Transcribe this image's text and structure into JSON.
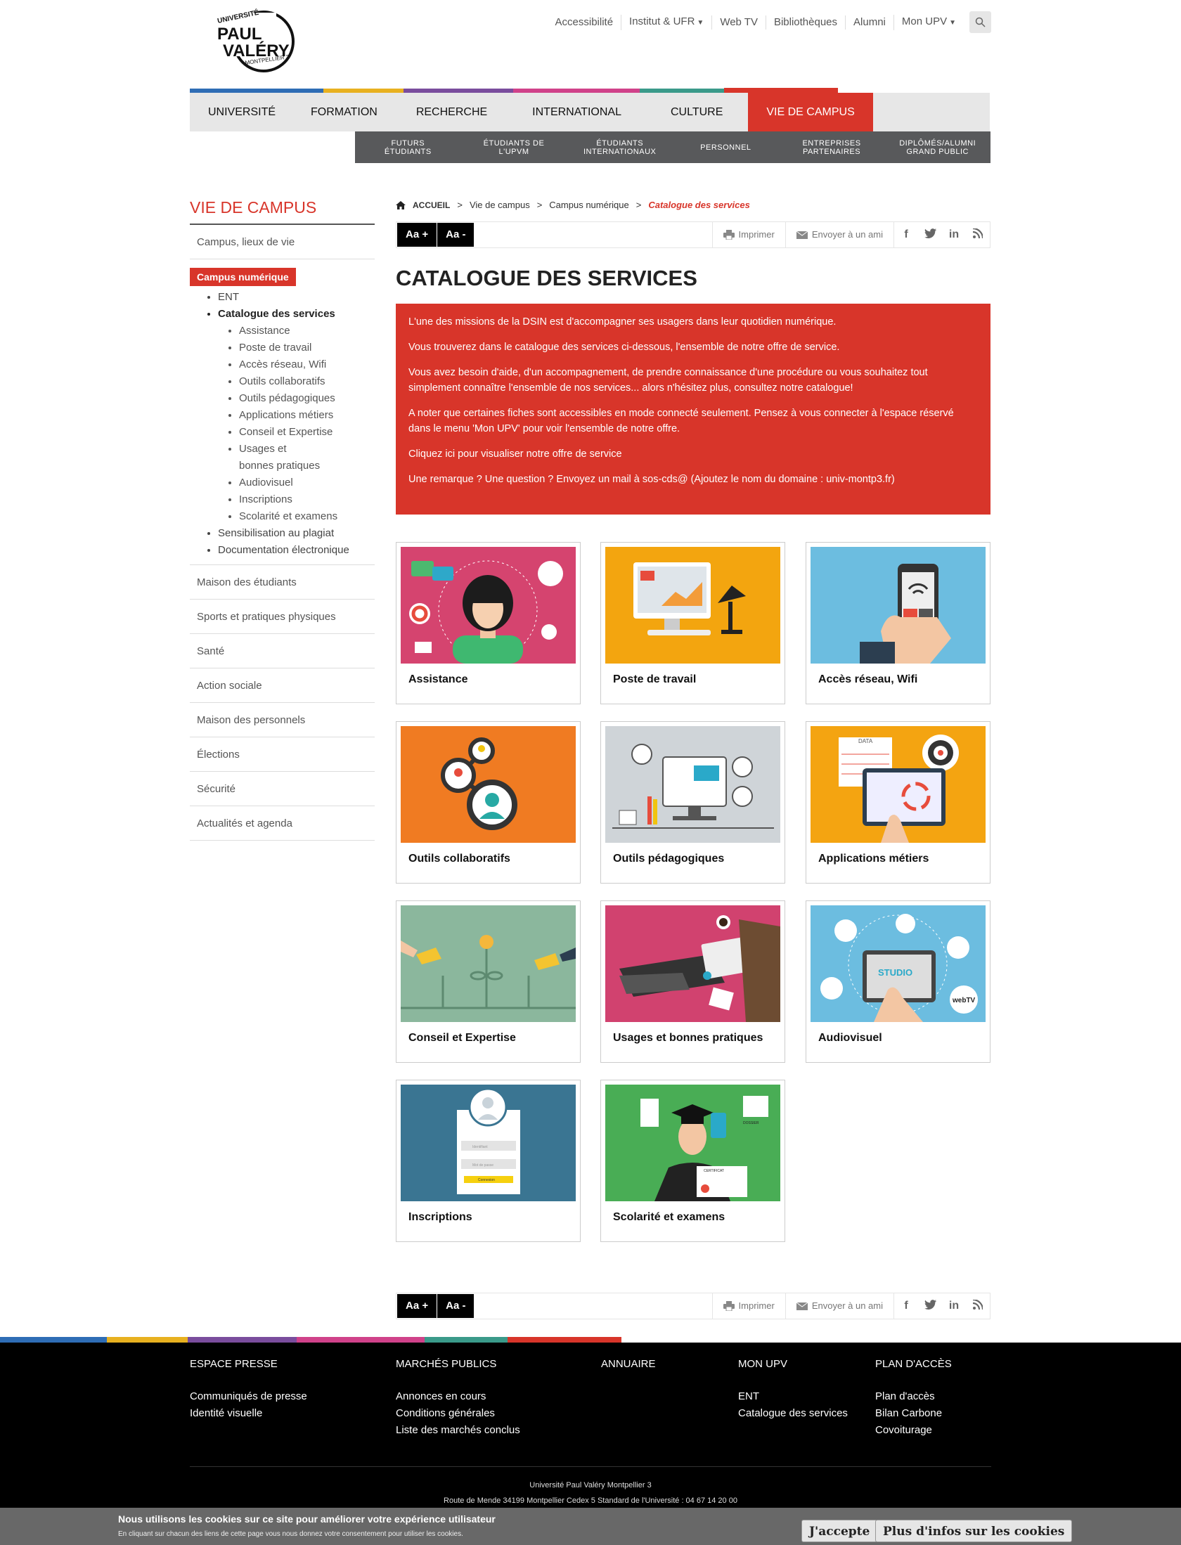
{
  "logo": {
    "line1": "UNIVERSITÉ",
    "line2": "PAUL",
    "line3": "VALÉRY",
    "line4": "MONTPELLIER 3"
  },
  "topnav": {
    "accessibilite": "Accessibilité",
    "institut": "Institut & UFR",
    "webtv": "Web TV",
    "bibliotheques": "Bibliothèques",
    "alumni": "Alumni",
    "monupv": "Mon UPV"
  },
  "colors": {
    "red": "#d8352a",
    "blue": "#2f6db5",
    "yellow": "#e8b120",
    "purple": "#7a4d9d",
    "pink": "#d0428a",
    "teal": "#3a9a8a"
  },
  "mainnav": [
    "Université",
    "Formation",
    "Recherche",
    "International",
    "Culture",
    "Vie de campus"
  ],
  "subnav": [
    "Futurs\nétudiants",
    "Étudiants de\nl'UPVM",
    "Étudiants\ninternationaux",
    "Personnel",
    "Entreprises\npartenaires",
    "Diplômés/Alumni\nGrand public"
  ],
  "sidebar": {
    "title": "Vie de campus",
    "item_campus": "Campus, lieux de vie",
    "active": "Campus numérique",
    "sub": [
      "ENT",
      "Catalogue des services",
      "Sensibilisation au plagiat",
      "Documentation électronique"
    ],
    "subsub": [
      "Assistance",
      "Poste de travail",
      "Accès réseau, Wifi",
      "Outils collaboratifs",
      "Outils pédagogiques",
      "Applications métiers",
      "Conseil et Expertise",
      "Usages et bonnes pratiques",
      "Audiovisuel",
      "Inscriptions",
      "Scolarité et examens"
    ],
    "rest": [
      "Maison des étudiants",
      "Sports et pratiques physiques",
      "Santé",
      "Action sociale",
      "Maison des personnels",
      "Élections",
      "Sécurité",
      "Actualités et agenda"
    ]
  },
  "breadcrumb": {
    "home": "ACCUEIL",
    "b1": "Vie de campus",
    "b2": "Campus numérique",
    "current": "Catalogue des services",
    "sep": ">"
  },
  "tools": {
    "aa_plus": "Aa +",
    "aa_minus": "Aa -",
    "print": "Imprimer",
    "email": "Envoyer à un ami"
  },
  "title": "Catalogue des services",
  "intro": [
    "L'une des missions de la DSIN est d'accompagner ses usagers dans leur quotidien numérique.",
    "Vous trouverez dans le catalogue des services ci-dessous, l'ensemble de notre offre de service.",
    "Vous avez besoin d'aide, d'un accompagnement, de prendre connaissance d'une procédure ou vous souhaitez tout simplement connaître l'ensemble de nos services... alors n'hésitez plus, consultez notre catalogue!",
    "A noter que certaines fiches sont accessibles en mode connecté seulement. Pensez à vous connecter à l'espace réservé dans le menu 'Mon UPV' pour voir l'ensemble de notre offre.",
    "Cliquez ici pour visualiser notre offre de service",
    "Une remarque ? Une question ? Envoyez un mail à sos-cds@ (Ajoutez le nom du domaine : univ-montp3.fr)"
  ],
  "cards": [
    {
      "label": "Assistance",
      "bg": "#d5446f"
    },
    {
      "label": "Poste de travail",
      "bg": "#f3a50f"
    },
    {
      "label": "Accès réseau, Wifi",
      "bg": "#6cbde0"
    },
    {
      "label": "Outils collaboratifs",
      "bg": "#f07b22"
    },
    {
      "label": "Outils pédagogiques",
      "bg": "#cfd4d8"
    },
    {
      "label": "Applications métiers",
      "bg": "#f4a411"
    },
    {
      "label": "Conseil et Expertise",
      "bg": "#8bb79d"
    },
    {
      "label": "Usages et bonnes pratiques",
      "bg": "#d1426f"
    },
    {
      "label": "Audiovisuel",
      "bg": "#6cbde0"
    },
    {
      "label": "Inscriptions",
      "bg": "#3a7592"
    },
    {
      "label": "Scolarité et examens",
      "bg": "#49ad55"
    }
  ],
  "card_texts": {
    "data": "DATA",
    "studio": "STUDIO",
    "webtv": "webTV",
    "identifiant": "Identifiant",
    "motdepasse": "Mot de passe",
    "connexion": "Connexion",
    "dossier": "DOSSIER",
    "certificat": "CERTIFICAT"
  },
  "footer": {
    "presse": {
      "title": "Espace presse",
      "links": [
        "Communiqués de presse",
        "Identité visuelle"
      ]
    },
    "marches": {
      "title": "Marchés publics",
      "links": [
        "Annonces en cours",
        "Conditions générales",
        "Liste des marchés conclus"
      ]
    },
    "annuaire": {
      "title": "Annuaire"
    },
    "monupv": {
      "title": "Mon UPV",
      "links": [
        "ENT",
        "Catalogue des services"
      ]
    },
    "plan": {
      "title": "Plan d'accès",
      "links": [
        "Plan d'accès",
        "Bilan Carbone",
        "Covoiturage"
      ]
    },
    "address1": "Université Paul Valéry Montpellier 3",
    "address2": "Route de Mende 34199 Montpellier Cedex 5 Standard de l'Université : 04 67 14 20 00"
  },
  "cookie": {
    "title": "Nous utilisons les cookies sur ce site pour améliorer votre expérience utilisateur",
    "text": "En cliquant sur chacun des liens de cette page vous nous donnez votre consentement pour utiliser les cookies.",
    "accept": "J'accepte",
    "more": "Plus d'infos sur les cookies"
  }
}
